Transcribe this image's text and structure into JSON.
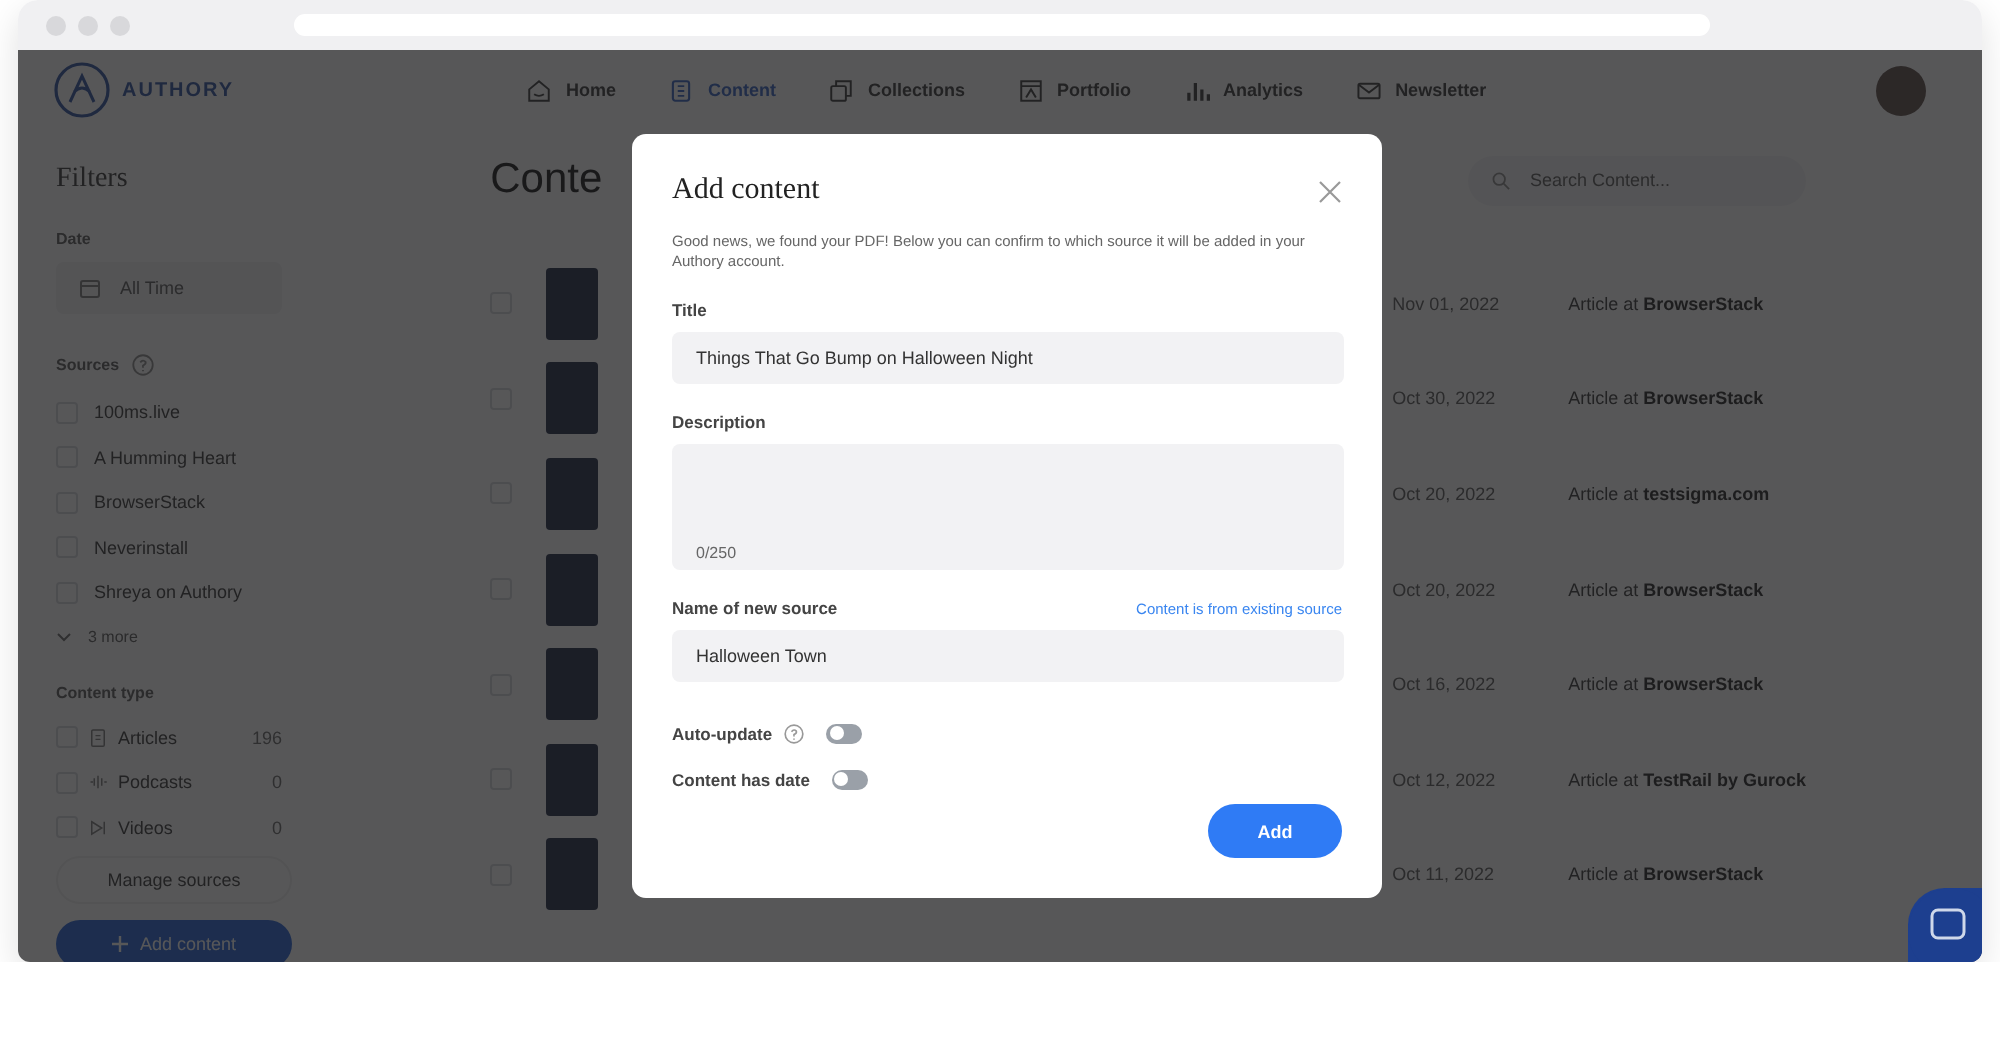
{
  "header": {
    "logo_text": "AUTHORY",
    "nav": [
      {
        "label": "Home",
        "kind": "home",
        "selected": false
      },
      {
        "label": "Content",
        "kind": "content",
        "selected": true
      },
      {
        "label": "Collections",
        "kind": "collections",
        "selected": false
      },
      {
        "label": "Portfolio",
        "kind": "portfolio",
        "selected": false
      },
      {
        "label": "Analytics",
        "kind": "analytics",
        "selected": false
      },
      {
        "label": "Newsletter",
        "kind": "newsletter",
        "selected": false
      }
    ]
  },
  "filters": {
    "title": "Filters",
    "date_label": "Date",
    "date_value": "All Time",
    "sources_label": "Sources",
    "sources": [
      {
        "label": "100ms.live",
        "checked": false
      },
      {
        "label": "A Humming Heart",
        "checked": false
      },
      {
        "label": "BrowserStack",
        "checked": false
      },
      {
        "label": "Neverinstall",
        "checked": false
      },
      {
        "label": "Shreya on Authory",
        "checked": false
      }
    ],
    "more": "3 more",
    "content_type_label": "Content type",
    "content_types": [
      {
        "kind": "article",
        "label": "Articles",
        "count": "196",
        "checked": false
      },
      {
        "kind": "podcast",
        "label": "Podcasts",
        "count": "0",
        "checked": false
      },
      {
        "kind": "video",
        "label": "Videos",
        "count": "0",
        "checked": false
      }
    ],
    "manage_button": "Manage sources",
    "add_button": "Add content"
  },
  "main": {
    "heading": "Conte",
    "search_placeholder": "Search Content...",
    "rows": [
      {
        "date": "Nov 01, 2022",
        "source": "Article at **BrowserStack**",
        "checked": false
      },
      {
        "date": "Oct 30, 2022",
        "source": "Article at **BrowserStack**",
        "checked": false
      },
      {
        "date": "Oct 20, 2022",
        "source": "Article at **testsigma.com**",
        "checked": false
      },
      {
        "date": "Oct 20, 2022",
        "source": "Article at **BrowserStack**",
        "checked": false
      },
      {
        "date": "Oct 16, 2022",
        "source": "Article at **BrowserStack**",
        "checked": false
      },
      {
        "date": "Oct 12, 2022",
        "source": "Article at **TestRail by Gurock**",
        "checked": false
      },
      {
        "date": "Oct 11, 2022",
        "source": "Article at **BrowserStack**",
        "checked": false
      }
    ]
  },
  "modal": {
    "title": "Add content",
    "message": "Good news, we found your PDF! Below you can confirm to which source it will be added in your Authory account.",
    "title_label": "Title",
    "title_value": "Things That Go Bump on Halloween Night",
    "description_label": "Description",
    "counter": "0/250",
    "source_label": "Name of new source",
    "source_link": "Content is from existing source",
    "source_value": "Halloween Town",
    "toggles": [
      {
        "label": "Auto-update",
        "help": true,
        "on": false
      },
      {
        "label": "Content has date",
        "help": false,
        "on": false
      }
    ],
    "add_button": "Add"
  }
}
